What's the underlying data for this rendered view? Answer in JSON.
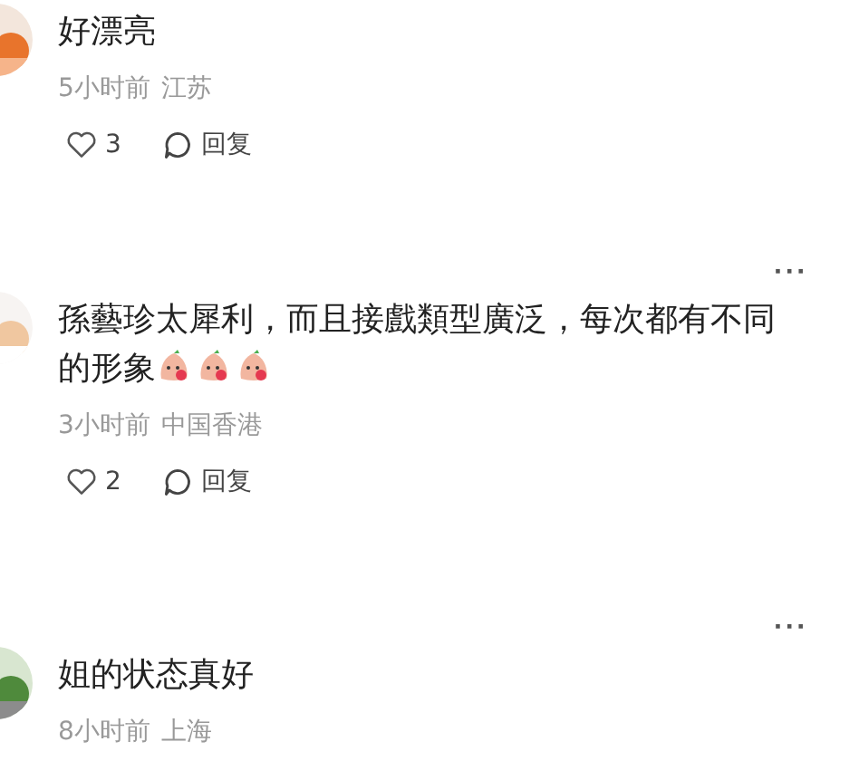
{
  "comments": [
    {
      "text": "好漂亮",
      "time": "5小时前",
      "location": "江苏",
      "likes": "3",
      "reply": "回复"
    },
    {
      "more": "···",
      "text": "孫藝珍太犀利，而且接戲類型廣泛，每次都有不同的形象",
      "emojis": [
        {
          "kind": "peach"
        },
        {
          "kind": "peach"
        },
        {
          "kind": "peach"
        }
      ],
      "time": "3小时前",
      "location": "中国香港",
      "likes": "2",
      "reply": "回复"
    },
    {
      "more": "···",
      "text": "姐的状态真好",
      "time": "8小时前",
      "location": "上海"
    }
  ]
}
